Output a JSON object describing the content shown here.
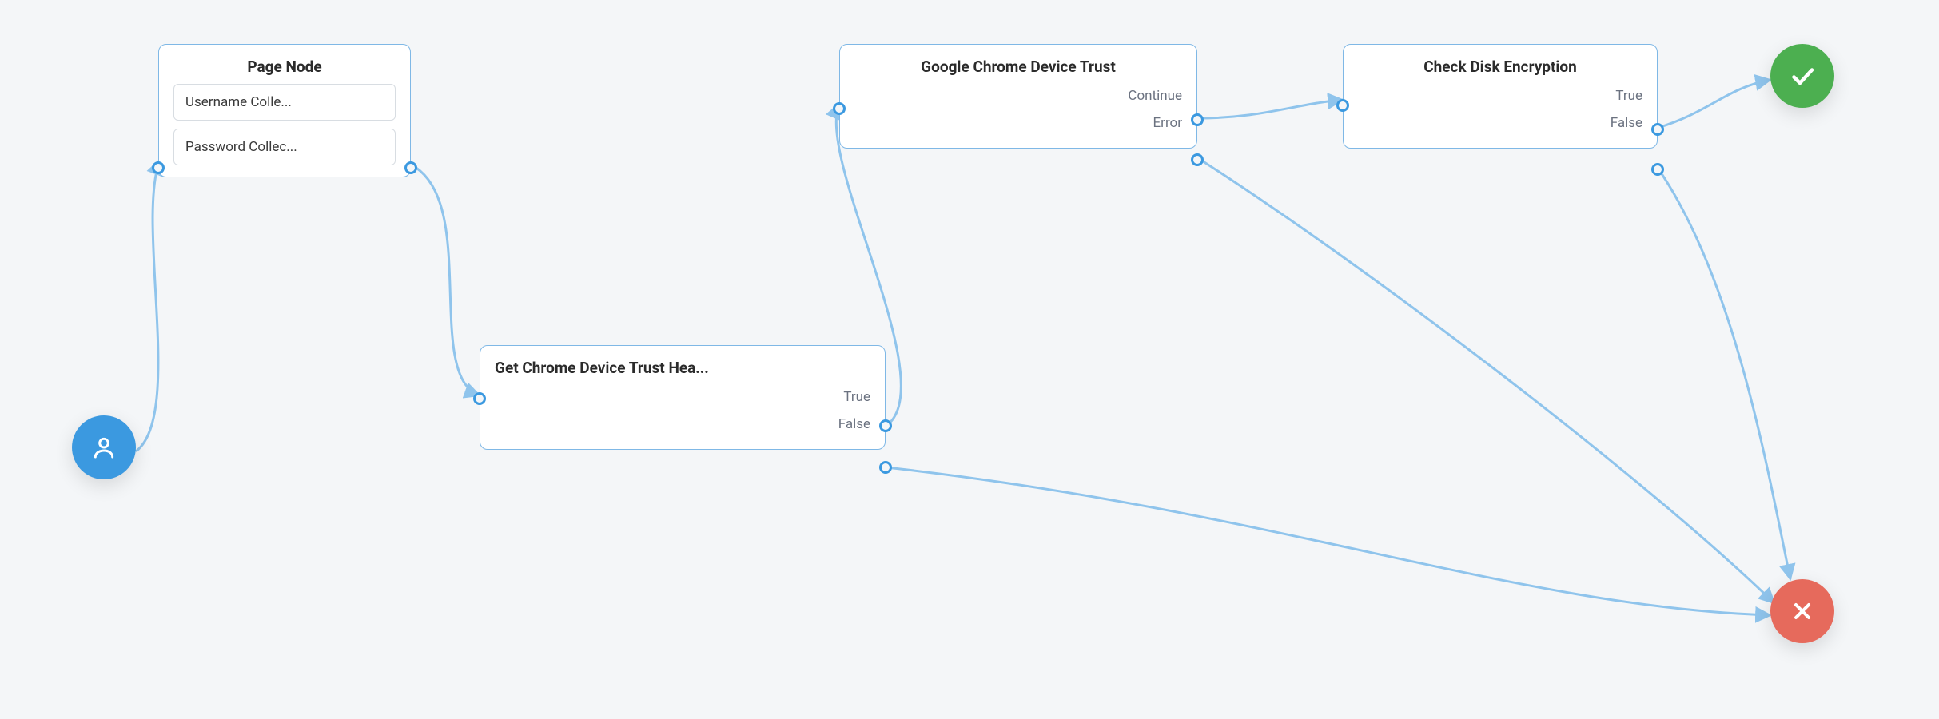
{
  "flow": {
    "start": {
      "icon": "person-icon"
    },
    "success": {
      "icon": "check-icon"
    },
    "fail": {
      "icon": "close-icon"
    },
    "nodes": {
      "page_node": {
        "title": "Page Node",
        "children": [
          "Username Colle...",
          "Password Collec..."
        ]
      },
      "get_headers": {
        "title": "Get Chrome Device Trust Hea...",
        "outputs": [
          "True",
          "False"
        ]
      },
      "device_trust": {
        "title": "Google Chrome Device Trust",
        "outputs": [
          "Continue",
          "Error"
        ]
      },
      "check_disk": {
        "title": "Check Disk Encryption",
        "outputs": [
          "True",
          "False"
        ]
      }
    }
  }
}
